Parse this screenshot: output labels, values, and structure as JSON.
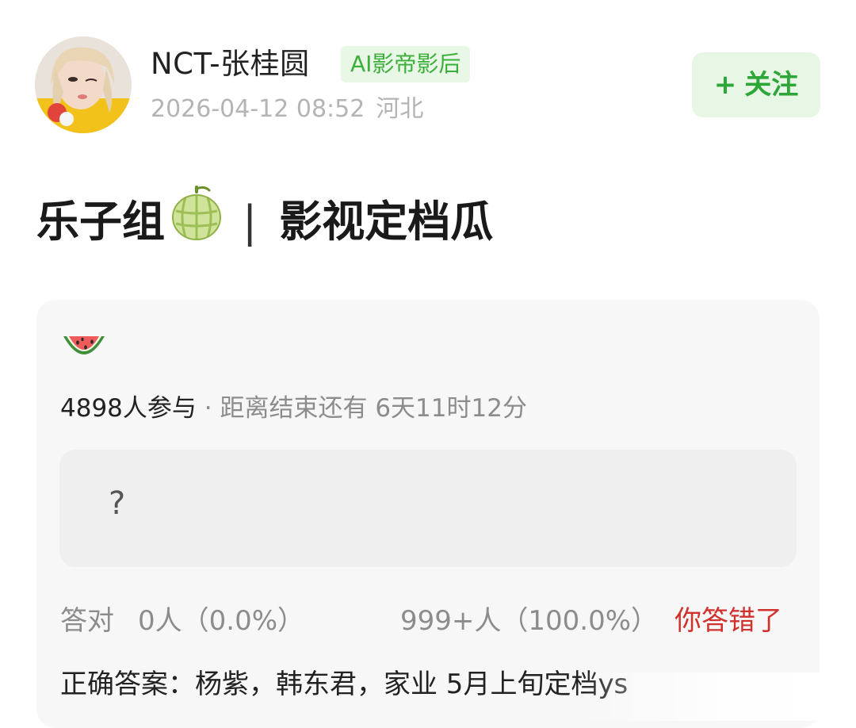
{
  "author": {
    "name": "NCT-张桂圆",
    "badge": "AI影帝影后",
    "datetime": "2026-04-12 08:52",
    "location": "河北"
  },
  "follow_button": {
    "plus": "+",
    "label": "关注"
  },
  "post": {
    "title_left": "乐子组",
    "title_separator": "|",
    "title_right": "影视定档瓜"
  },
  "quiz": {
    "participants": "4898人参与",
    "dot": "·",
    "countdown": "距离结束还有 6天11时12分",
    "option_text": "?",
    "correct_label": "答对",
    "correct_count": "0人（0.0%）",
    "other_count": "999+人（100.0%）",
    "wrong_label": "你答错了",
    "answer": "正确答案：杨紫，韩东君，家业 5月上旬定档ys"
  },
  "colors": {
    "badge_green": "#3caf3a",
    "follow_green": "#2ba637",
    "wrong_red": "#d0312d",
    "muted_gray": "#8c8c8c"
  },
  "icons": [
    "avatar",
    "melon-icon",
    "watermelon-icon"
  ]
}
